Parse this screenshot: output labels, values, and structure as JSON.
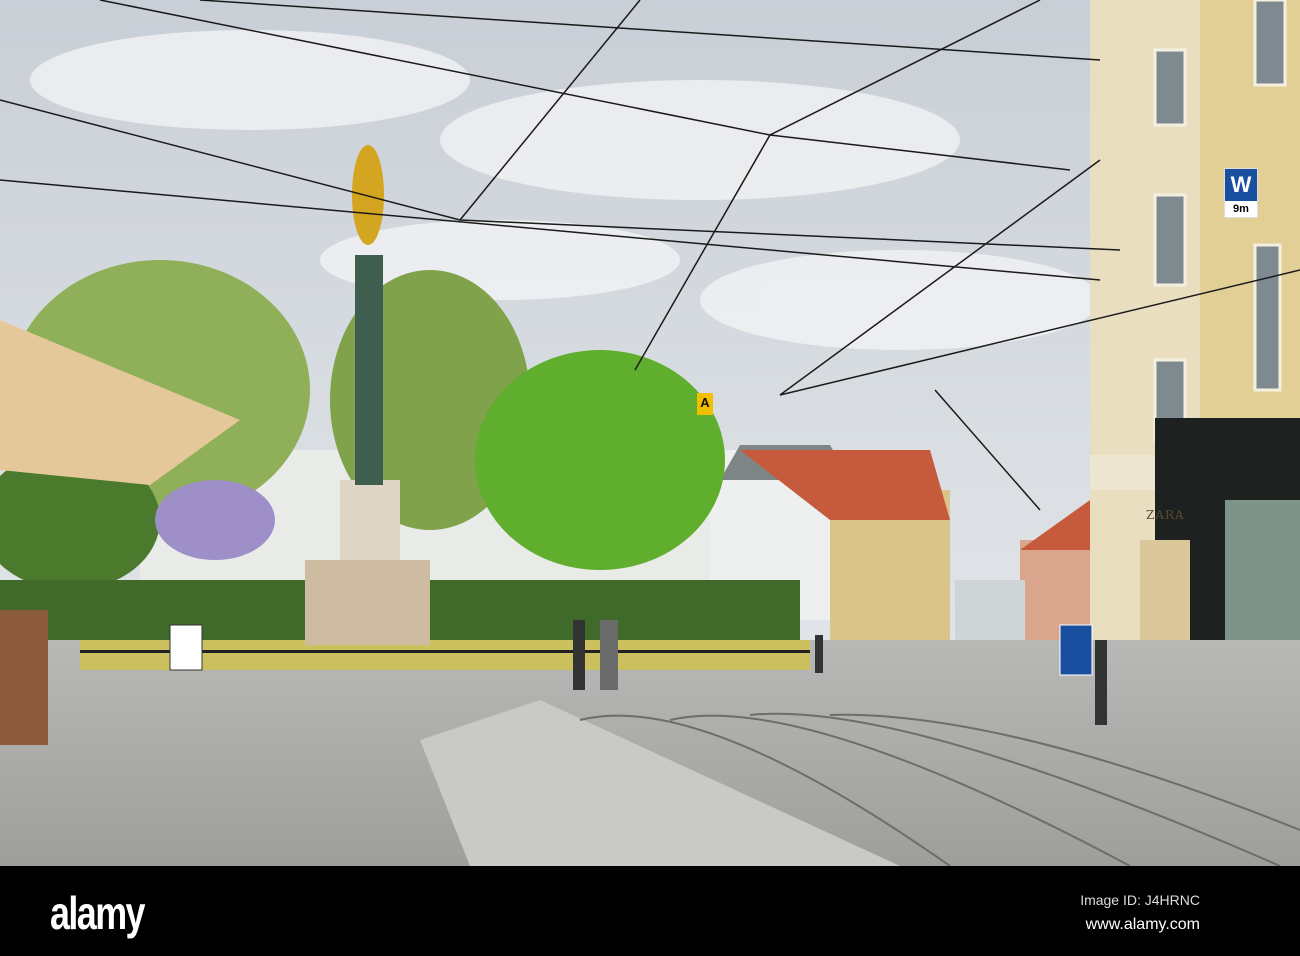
{
  "photo": {
    "signs": {
      "zara": "ZARA",
      "w_letter": "W",
      "w_distance": "9m",
      "a_letter": "A"
    }
  },
  "watermark_bar": {
    "logo": "alamy",
    "image_id": "Image ID: J4HRNC",
    "url": "www.alamy.com"
  }
}
